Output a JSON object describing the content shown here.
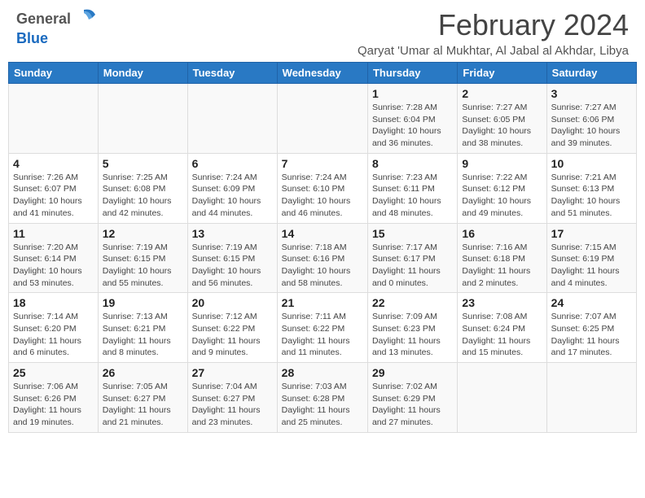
{
  "header": {
    "logo": {
      "line1": "General",
      "line2": "Blue"
    },
    "title": "February 2024",
    "subtitle": "Qaryat 'Umar al Mukhtar, Al Jabal al Akhdar, Libya"
  },
  "calendar": {
    "days_of_week": [
      "Sunday",
      "Monday",
      "Tuesday",
      "Wednesday",
      "Thursday",
      "Friday",
      "Saturday"
    ],
    "weeks": [
      [
        {
          "day": "",
          "info": ""
        },
        {
          "day": "",
          "info": ""
        },
        {
          "day": "",
          "info": ""
        },
        {
          "day": "",
          "info": ""
        },
        {
          "day": "1",
          "info": "Sunrise: 7:28 AM\nSunset: 6:04 PM\nDaylight: 10 hours and 36 minutes."
        },
        {
          "day": "2",
          "info": "Sunrise: 7:27 AM\nSunset: 6:05 PM\nDaylight: 10 hours and 38 minutes."
        },
        {
          "day": "3",
          "info": "Sunrise: 7:27 AM\nSunset: 6:06 PM\nDaylight: 10 hours and 39 minutes."
        }
      ],
      [
        {
          "day": "4",
          "info": "Sunrise: 7:26 AM\nSunset: 6:07 PM\nDaylight: 10 hours and 41 minutes."
        },
        {
          "day": "5",
          "info": "Sunrise: 7:25 AM\nSunset: 6:08 PM\nDaylight: 10 hours and 42 minutes."
        },
        {
          "day": "6",
          "info": "Sunrise: 7:24 AM\nSunset: 6:09 PM\nDaylight: 10 hours and 44 minutes."
        },
        {
          "day": "7",
          "info": "Sunrise: 7:24 AM\nSunset: 6:10 PM\nDaylight: 10 hours and 46 minutes."
        },
        {
          "day": "8",
          "info": "Sunrise: 7:23 AM\nSunset: 6:11 PM\nDaylight: 10 hours and 48 minutes."
        },
        {
          "day": "9",
          "info": "Sunrise: 7:22 AM\nSunset: 6:12 PM\nDaylight: 10 hours and 49 minutes."
        },
        {
          "day": "10",
          "info": "Sunrise: 7:21 AM\nSunset: 6:13 PM\nDaylight: 10 hours and 51 minutes."
        }
      ],
      [
        {
          "day": "11",
          "info": "Sunrise: 7:20 AM\nSunset: 6:14 PM\nDaylight: 10 hours and 53 minutes."
        },
        {
          "day": "12",
          "info": "Sunrise: 7:19 AM\nSunset: 6:15 PM\nDaylight: 10 hours and 55 minutes."
        },
        {
          "day": "13",
          "info": "Sunrise: 7:19 AM\nSunset: 6:15 PM\nDaylight: 10 hours and 56 minutes."
        },
        {
          "day": "14",
          "info": "Sunrise: 7:18 AM\nSunset: 6:16 PM\nDaylight: 10 hours and 58 minutes."
        },
        {
          "day": "15",
          "info": "Sunrise: 7:17 AM\nSunset: 6:17 PM\nDaylight: 11 hours and 0 minutes."
        },
        {
          "day": "16",
          "info": "Sunrise: 7:16 AM\nSunset: 6:18 PM\nDaylight: 11 hours and 2 minutes."
        },
        {
          "day": "17",
          "info": "Sunrise: 7:15 AM\nSunset: 6:19 PM\nDaylight: 11 hours and 4 minutes."
        }
      ],
      [
        {
          "day": "18",
          "info": "Sunrise: 7:14 AM\nSunset: 6:20 PM\nDaylight: 11 hours and 6 minutes."
        },
        {
          "day": "19",
          "info": "Sunrise: 7:13 AM\nSunset: 6:21 PM\nDaylight: 11 hours and 8 minutes."
        },
        {
          "day": "20",
          "info": "Sunrise: 7:12 AM\nSunset: 6:22 PM\nDaylight: 11 hours and 9 minutes."
        },
        {
          "day": "21",
          "info": "Sunrise: 7:11 AM\nSunset: 6:22 PM\nDaylight: 11 hours and 11 minutes."
        },
        {
          "day": "22",
          "info": "Sunrise: 7:09 AM\nSunset: 6:23 PM\nDaylight: 11 hours and 13 minutes."
        },
        {
          "day": "23",
          "info": "Sunrise: 7:08 AM\nSunset: 6:24 PM\nDaylight: 11 hours and 15 minutes."
        },
        {
          "day": "24",
          "info": "Sunrise: 7:07 AM\nSunset: 6:25 PM\nDaylight: 11 hours and 17 minutes."
        }
      ],
      [
        {
          "day": "25",
          "info": "Sunrise: 7:06 AM\nSunset: 6:26 PM\nDaylight: 11 hours and 19 minutes."
        },
        {
          "day": "26",
          "info": "Sunrise: 7:05 AM\nSunset: 6:27 PM\nDaylight: 11 hours and 21 minutes."
        },
        {
          "day": "27",
          "info": "Sunrise: 7:04 AM\nSunset: 6:27 PM\nDaylight: 11 hours and 23 minutes."
        },
        {
          "day": "28",
          "info": "Sunrise: 7:03 AM\nSunset: 6:28 PM\nDaylight: 11 hours and 25 minutes."
        },
        {
          "day": "29",
          "info": "Sunrise: 7:02 AM\nSunset: 6:29 PM\nDaylight: 11 hours and 27 minutes."
        },
        {
          "day": "",
          "info": ""
        },
        {
          "day": "",
          "info": ""
        }
      ]
    ]
  }
}
